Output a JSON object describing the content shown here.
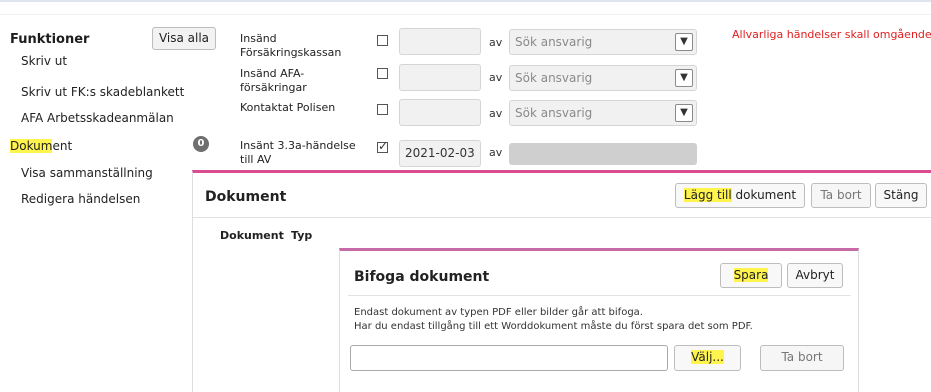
{
  "sidebar": {
    "title": "Funktioner",
    "visa_alla": "Visa alla",
    "items": [
      {
        "label": "Skriv ut"
      },
      {
        "label": "Skriv ut FK:s skadeblankett"
      },
      {
        "label": "AFA Arbetsskadeanmälan"
      },
      {
        "label_hl": "Dokum",
        "label_rest": "ent"
      },
      {
        "label": "Visa sammanställning"
      },
      {
        "label": "Redigera händelsen"
      }
    ],
    "badge_count": "0"
  },
  "form": {
    "rows": [
      {
        "label": "Insänd Försäkringskassan",
        "checked": false,
        "date": "",
        "av": "av",
        "responsible_placeholder": "Sök ansvarig"
      },
      {
        "label": "Insänd AFA-försäkringar",
        "checked": false,
        "date": "",
        "av": "av",
        "responsible_placeholder": "Sök ansvarig"
      },
      {
        "label": "Kontaktat Polisen",
        "checked": false,
        "date": "",
        "av": "av",
        "responsible_placeholder": "Sök ansvarig"
      },
      {
        "label": "Insänt 3.3a-händelse till AV",
        "checked": true,
        "date": "2021-02-03",
        "av": "av",
        "responsible_placeholder": ""
      }
    ],
    "warning": "Allvarliga händelser skall omgående"
  },
  "dokument_dialog": {
    "title": "Dokument",
    "add_hl": "Lägg till",
    "add_rest": " dokument",
    "remove": "Ta bort",
    "close": "Stäng",
    "columns": [
      "Dokument",
      "Typ"
    ]
  },
  "bifoga_dialog": {
    "title": "Bifoga dokument",
    "save": "Spara",
    "cancel": "Avbryt",
    "info_line1": "Endast dokument av typen PDF eller bilder går att bifoga.",
    "info_line2": "Har du endast tillgång till ett Worddokument måste du först spara det som PDF.",
    "choose": "Välj...",
    "remove": "Ta bort"
  },
  "colors": {
    "highlight": "#fff34d",
    "warning": "#e02020",
    "dialog_border": "#d94d8f"
  }
}
